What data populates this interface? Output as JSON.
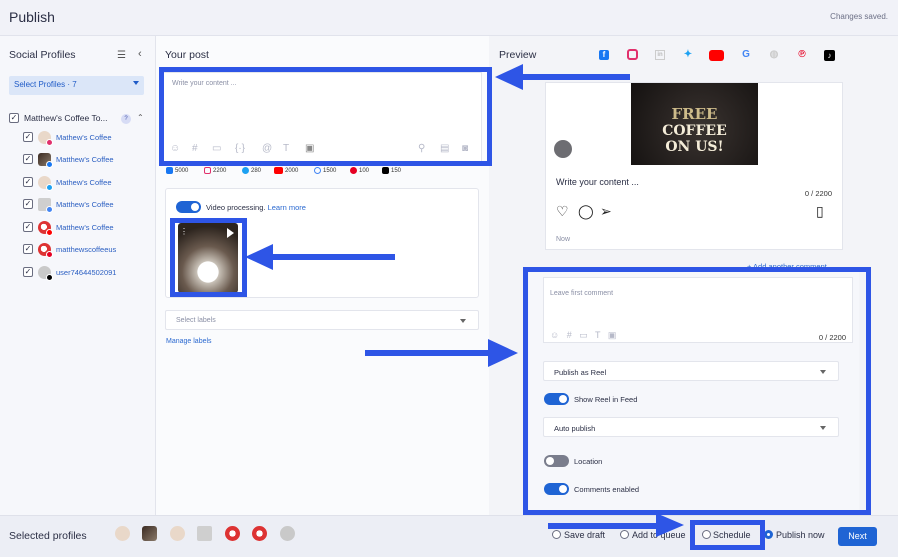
{
  "app": {
    "title": "Publish",
    "status": "Changes saved."
  },
  "sidebar": {
    "title": "Social Profiles",
    "select_label": "Select Profiles · 7",
    "group": {
      "label": "Matthew's Coffee To...",
      "badge": "?"
    },
    "profiles": [
      {
        "name": "Mathew's Coffee",
        "network": "instagram"
      },
      {
        "name": "Matthew's Coffee",
        "network": "facebook"
      },
      {
        "name": "Mathew's Coffee",
        "network": "twitter"
      },
      {
        "name": "Matthew's Coffee",
        "network": "google-business"
      },
      {
        "name": "Matthew's Coffee",
        "network": "youtube"
      },
      {
        "name": "matthewscoffeeus",
        "network": "pinterest"
      },
      {
        "name": "user74644502091",
        "network": "tiktok"
      }
    ]
  },
  "post": {
    "title": "Your post",
    "placeholder": "Write your content ...",
    "counts": [
      {
        "network": "facebook",
        "value": "5000",
        "color": "#1877f2"
      },
      {
        "network": "instagram",
        "value": "2200",
        "color": "#e1306c"
      },
      {
        "network": "twitter",
        "value": "280",
        "color": "#1da1f2"
      },
      {
        "network": "youtube",
        "value": "2000",
        "color": "#ff0000"
      },
      {
        "network": "google",
        "value": "1500",
        "color": "#4285f4"
      },
      {
        "network": "pinterest",
        "value": "100",
        "color": "#e60023"
      },
      {
        "network": "tiktok",
        "value": "150",
        "color": "#000000"
      }
    ],
    "video_processing": "Video processing.",
    "learn_more": "Learn more",
    "labels_placeholder": "Select labels",
    "manage_labels": "Manage labels"
  },
  "preview": {
    "title": "Preview",
    "image_text": [
      "FREE",
      "COFFEE",
      "ON US!"
    ],
    "content": "Write your content ...",
    "count": "0 / 2200",
    "time": "Now",
    "add_comment": "+ Add another comment",
    "first_comment_placeholder": "Leave first comment",
    "first_comment_count": "0 / 2200",
    "publish_as": "Publish as Reel",
    "show_reel": "Show Reel in Feed",
    "auto_publish": "Auto publish",
    "location": "Location",
    "comments_enabled": "Comments enabled"
  },
  "footer": {
    "selected_profiles": "Selected profiles",
    "save_draft": "Save draft",
    "add_queue": "Add to queue",
    "schedule": "Schedule",
    "publish_now": "Publish now",
    "next": "Next"
  },
  "colors": {
    "accent": "#1f64d4",
    "highlight": "#2e55e6"
  }
}
